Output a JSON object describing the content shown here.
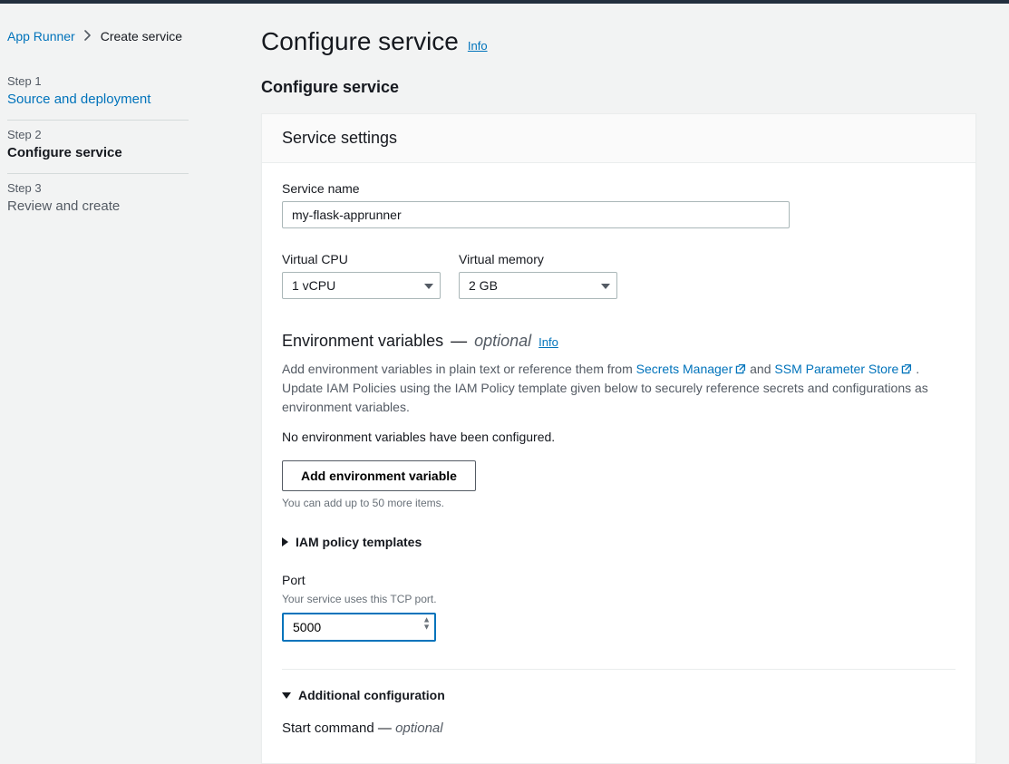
{
  "breadcrumbs": {
    "root": "App Runner",
    "current": "Create service"
  },
  "sidebar": {
    "steps": [
      {
        "num": "Step 1",
        "title": "Source and deployment"
      },
      {
        "num": "Step 2",
        "title": "Configure service"
      },
      {
        "num": "Step 3",
        "title": "Review and create"
      }
    ]
  },
  "page": {
    "title": "Configure service",
    "info_label": "Info",
    "section_heading": "Configure service"
  },
  "panel": {
    "header": "Service settings",
    "service_name_label": "Service name",
    "service_name_value": "my-flask-apprunner",
    "vcpu_label": "Virtual CPU",
    "vcpu_value": "1 vCPU",
    "vmem_label": "Virtual memory",
    "vmem_value": "2 GB"
  },
  "env": {
    "heading": "Environment variables",
    "optional": "optional",
    "info_label": "Info",
    "help_pre": "Add environment variables in plain text or reference them from ",
    "link1": "Secrets Manager",
    "help_mid": " and ",
    "link2": "SSM Parameter Store",
    "help_post": ". Update IAM Policies using the IAM Policy template given below to securely reference secrets and configurations as environment variables.",
    "none_configured": "No environment variables have been configured.",
    "add_button": "Add environment variable",
    "add_limit": "You can add up to 50 more items.",
    "iam_expander": "IAM policy templates"
  },
  "port": {
    "label": "Port",
    "help": "Your service uses this TCP port.",
    "value": "5000"
  },
  "add_cfg": {
    "heading": "Additional configuration"
  },
  "start_cmd": {
    "label": "Start command",
    "optional": "optional"
  }
}
